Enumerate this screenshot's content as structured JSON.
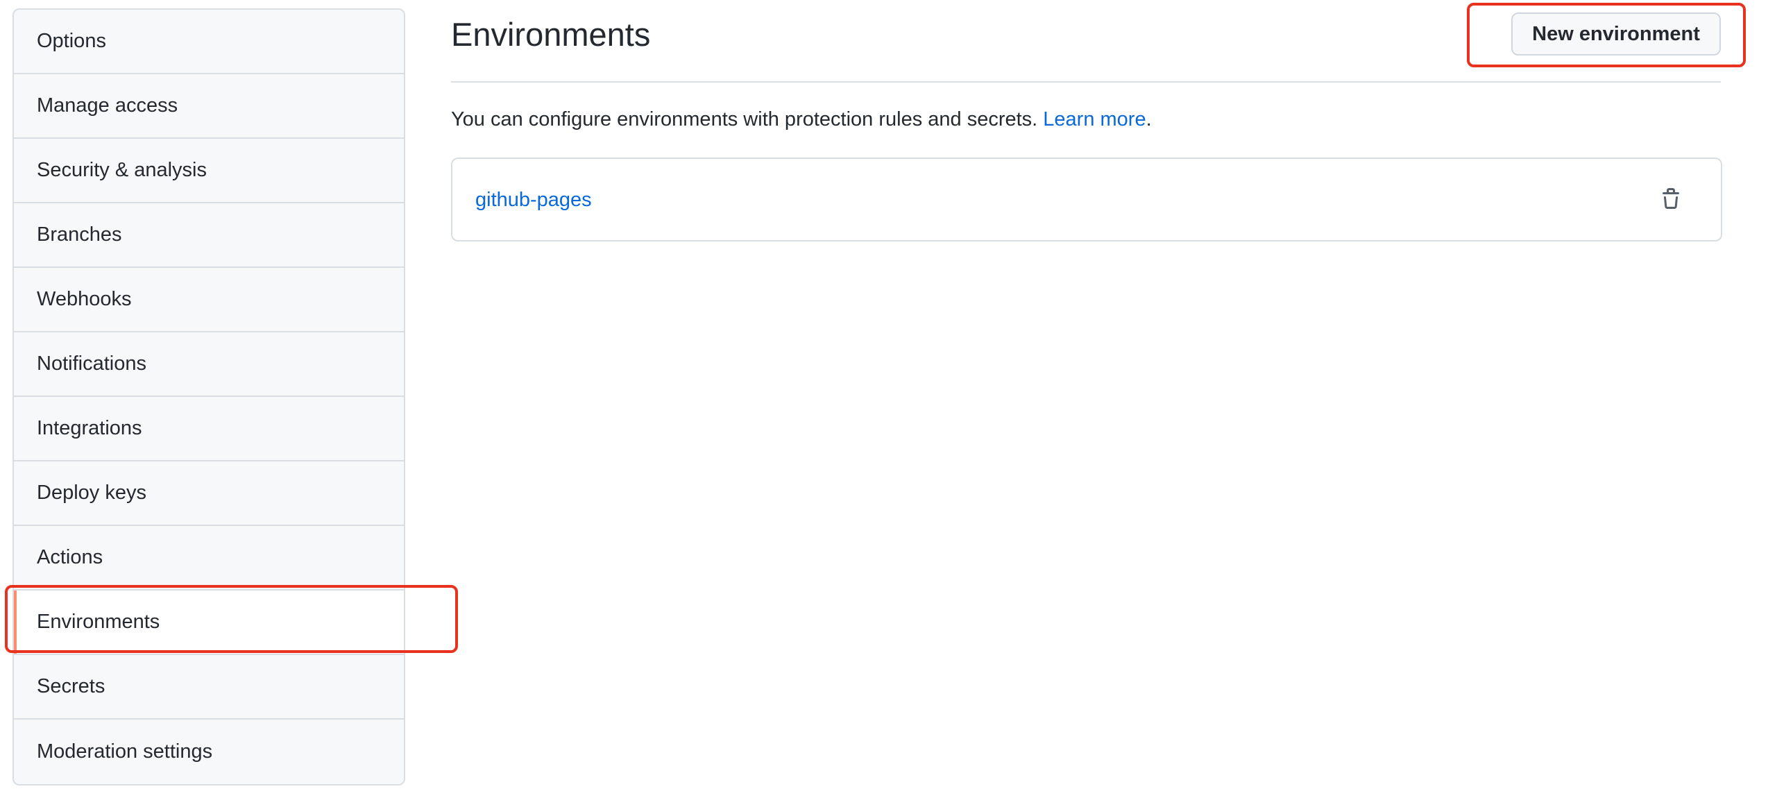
{
  "sidebar": {
    "items": [
      {
        "label": "Options"
      },
      {
        "label": "Manage access"
      },
      {
        "label": "Security & analysis"
      },
      {
        "label": "Branches"
      },
      {
        "label": "Webhooks"
      },
      {
        "label": "Notifications"
      },
      {
        "label": "Integrations"
      },
      {
        "label": "Deploy keys"
      },
      {
        "label": "Actions"
      },
      {
        "label": "Environments",
        "active": true
      },
      {
        "label": "Secrets"
      },
      {
        "label": "Moderation settings"
      }
    ]
  },
  "header": {
    "title": "Environments",
    "new_button_label": "New environment"
  },
  "description": {
    "text": "You can configure environments with protection rules and secrets. ",
    "link_text": "Learn more",
    "suffix": "."
  },
  "environments": [
    {
      "name": "github-pages",
      "action_icon": "trash-icon"
    }
  ],
  "colors": {
    "accent_link": "#0969da",
    "highlight": "#e8321f",
    "active_marker": "#fd8c73"
  }
}
